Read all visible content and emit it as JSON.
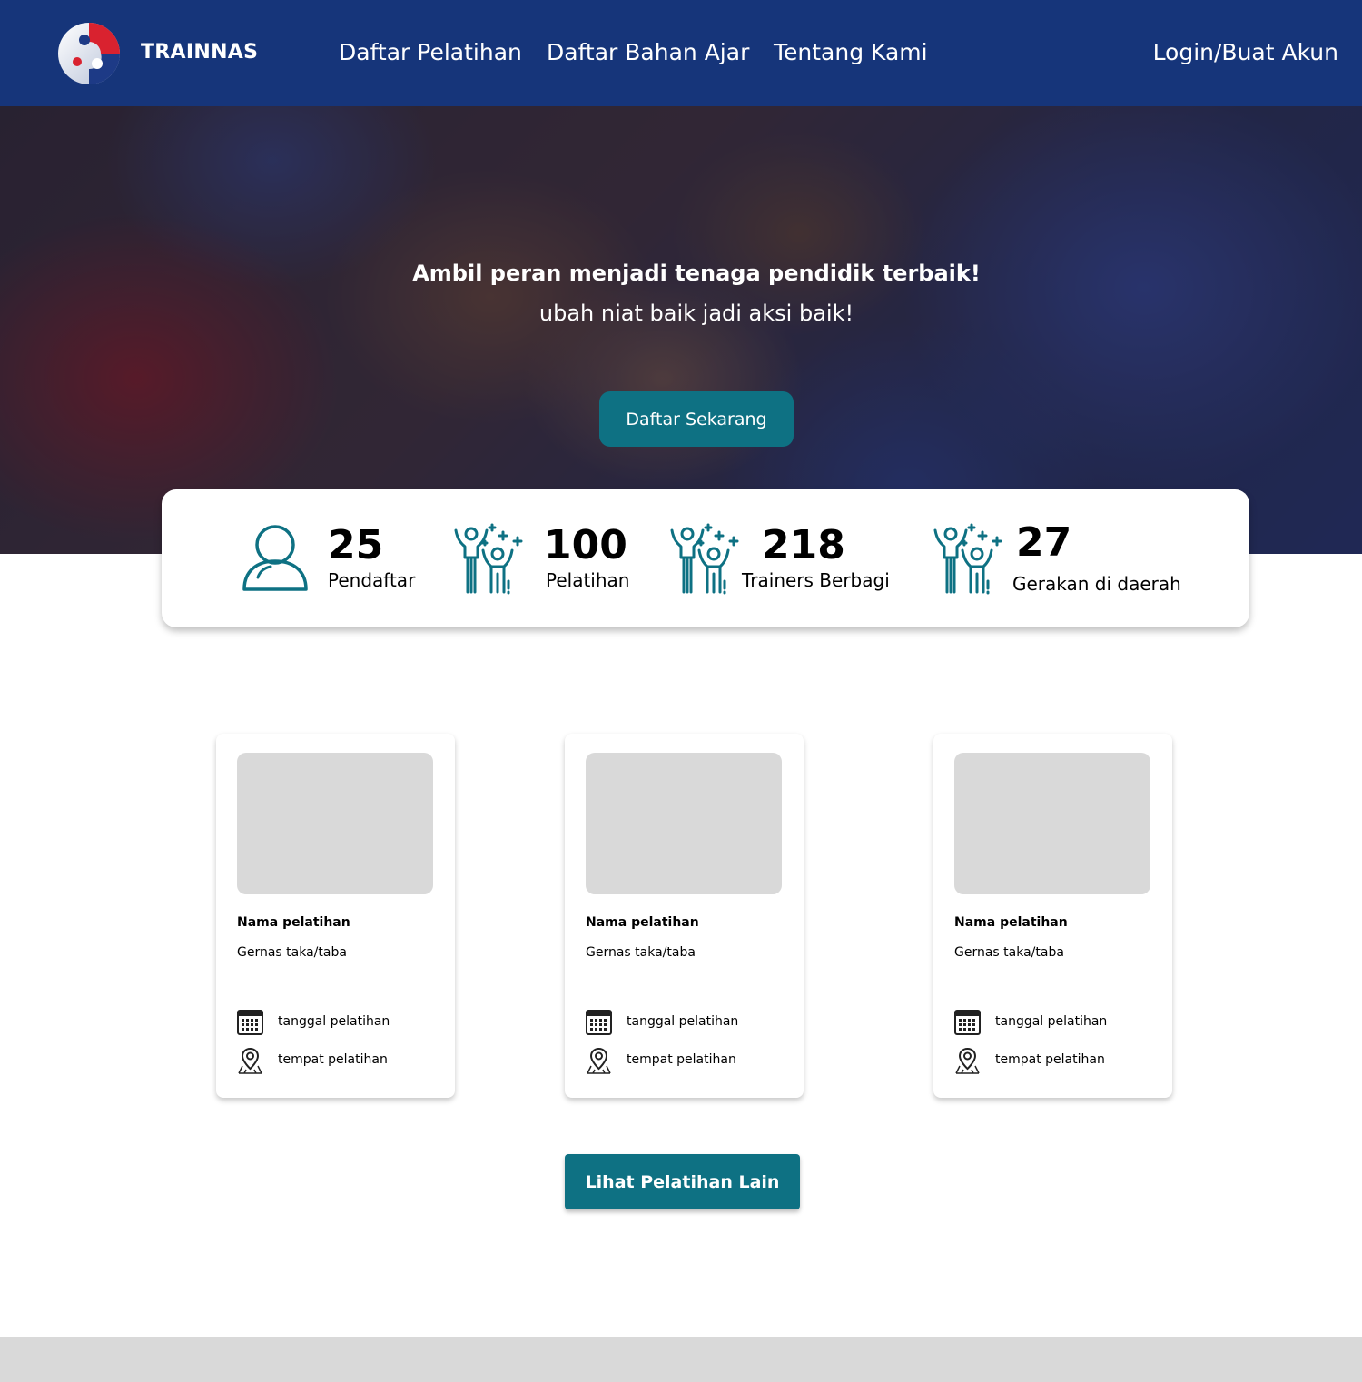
{
  "colors": {
    "navbar": "#16357a",
    "accent": "#0e7183",
    "placeholder": "#d9d9d9",
    "footer": "#d9d9d9"
  },
  "navbar": {
    "brand": "TRAINNAS",
    "links": [
      "Daftar Pelatihan",
      "Daftar Bahan Ajar",
      "Tentang Kami"
    ],
    "login": "Login/Buat Akun"
  },
  "hero": {
    "title": "Ambil peran menjadi tenaga pendidik terbaik!",
    "subtitle": "ubah niat baik jadi aksi baik!",
    "cta": "Daftar Sekarang"
  },
  "stats": [
    {
      "icon": "user-icon",
      "value": "25",
      "label": "Pendaftar"
    },
    {
      "icon": "group-celebrate-icon",
      "value": "100",
      "label": "Pelatihan"
    },
    {
      "icon": "group-celebrate-icon",
      "value": "218",
      "label": "Trainers Berbagi"
    },
    {
      "icon": "group-celebrate-icon",
      "value": "27",
      "label": "Gerakan di daerah"
    }
  ],
  "cards": [
    {
      "name": "Nama pelatihan",
      "org": "Gernas taka/taba",
      "date": "tanggal pelatihan",
      "place": "tempat pelatihan"
    },
    {
      "name": "Nama pelatihan",
      "org": "Gernas taka/taba",
      "date": "tanggal pelatihan",
      "place": "tempat pelatihan"
    },
    {
      "name": "Nama pelatihan",
      "org": "Gernas taka/taba",
      "date": "tanggal pelatihan",
      "place": "tempat pelatihan"
    }
  ],
  "more_button": "Lihat Pelatihan Lain"
}
